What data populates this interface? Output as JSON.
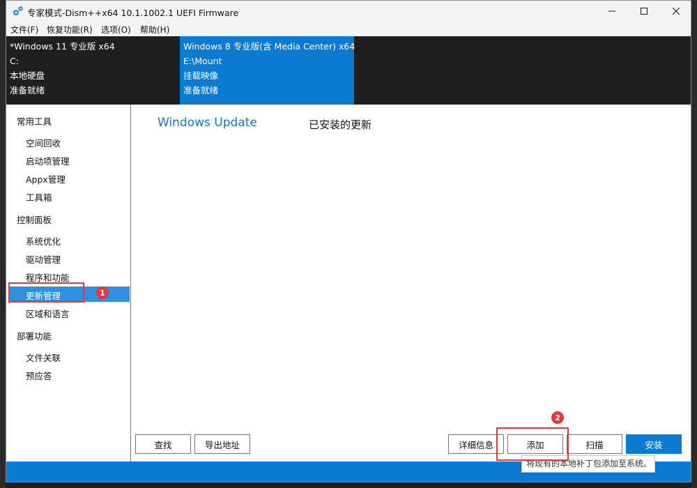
{
  "window": {
    "title": "专家模式-Dism++x64 10.1.1002.1 UEFI Firmware"
  },
  "menu": [
    {
      "label": "文件(F)"
    },
    {
      "label": "恢复功能(R)"
    },
    {
      "label": "选项(O)"
    },
    {
      "label": "帮助(H)"
    }
  ],
  "sessions": [
    {
      "name": "*Windows 11 专业版 x64",
      "path": "C:",
      "type": "本地硬盘",
      "status": "准备就绪",
      "active": false
    },
    {
      "name": "Windows 8 专业版(含 Media Center) x64",
      "path": "E:\\Mount",
      "type": "挂载映像",
      "status": "准备就绪",
      "active": true
    }
  ],
  "sidebar": {
    "cat_tools": "常用工具",
    "space_reclaim": "空间回收",
    "startup_mgmt": "启动项管理",
    "appx_mgmt": "Appx管理",
    "toolbox": "工具箱",
    "cat_control": "控制面板",
    "sys_optimize": "系统优化",
    "driver_mgmt": "驱动管理",
    "programs": "程序和功能",
    "update_mgmt": "更新管理",
    "region_lang": "区域和语言",
    "cat_deploy": "部署功能",
    "file_assoc": "文件关联",
    "preanswer": "预应答"
  },
  "content": {
    "title": "Windows Update",
    "subtitle": "已安装的更新"
  },
  "buttons": {
    "find": "查找",
    "export": "导出地址",
    "details": "详细信息",
    "add": "添加",
    "scan": "扫描",
    "install": "安装"
  },
  "tooltip": "将现有的本地补丁包添加至系统。",
  "annotations": {
    "badge1": "1",
    "badge2": "2"
  },
  "colors": {
    "accent": "#0a7bd0",
    "selection": "#2f8fe0",
    "annotation": "#e2373d"
  }
}
